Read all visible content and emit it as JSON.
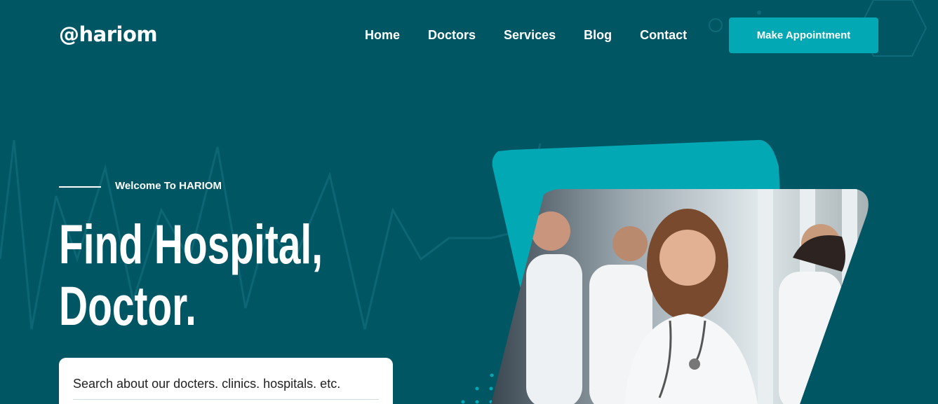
{
  "header": {
    "logo": "@hariom",
    "nav": [
      "Home",
      "Doctors",
      "Services",
      "Blog",
      "Contact"
    ],
    "cta_label": "Make Appointment"
  },
  "hero": {
    "welcome": "Welcome To HARIOM",
    "headline_line1": "Find Hospital,",
    "headline_line2": "Doctor.",
    "search_placeholder": "Search about our docters. clinics. hospitals. etc."
  },
  "colors": {
    "background": "#015664",
    "accent": "#02a8b4",
    "text": "#ffffff"
  },
  "icons": [
    "heartbeat-line-decoration",
    "hexagon-decoration",
    "dot-pattern-decoration"
  ],
  "image": "group-of-doctors-photo"
}
